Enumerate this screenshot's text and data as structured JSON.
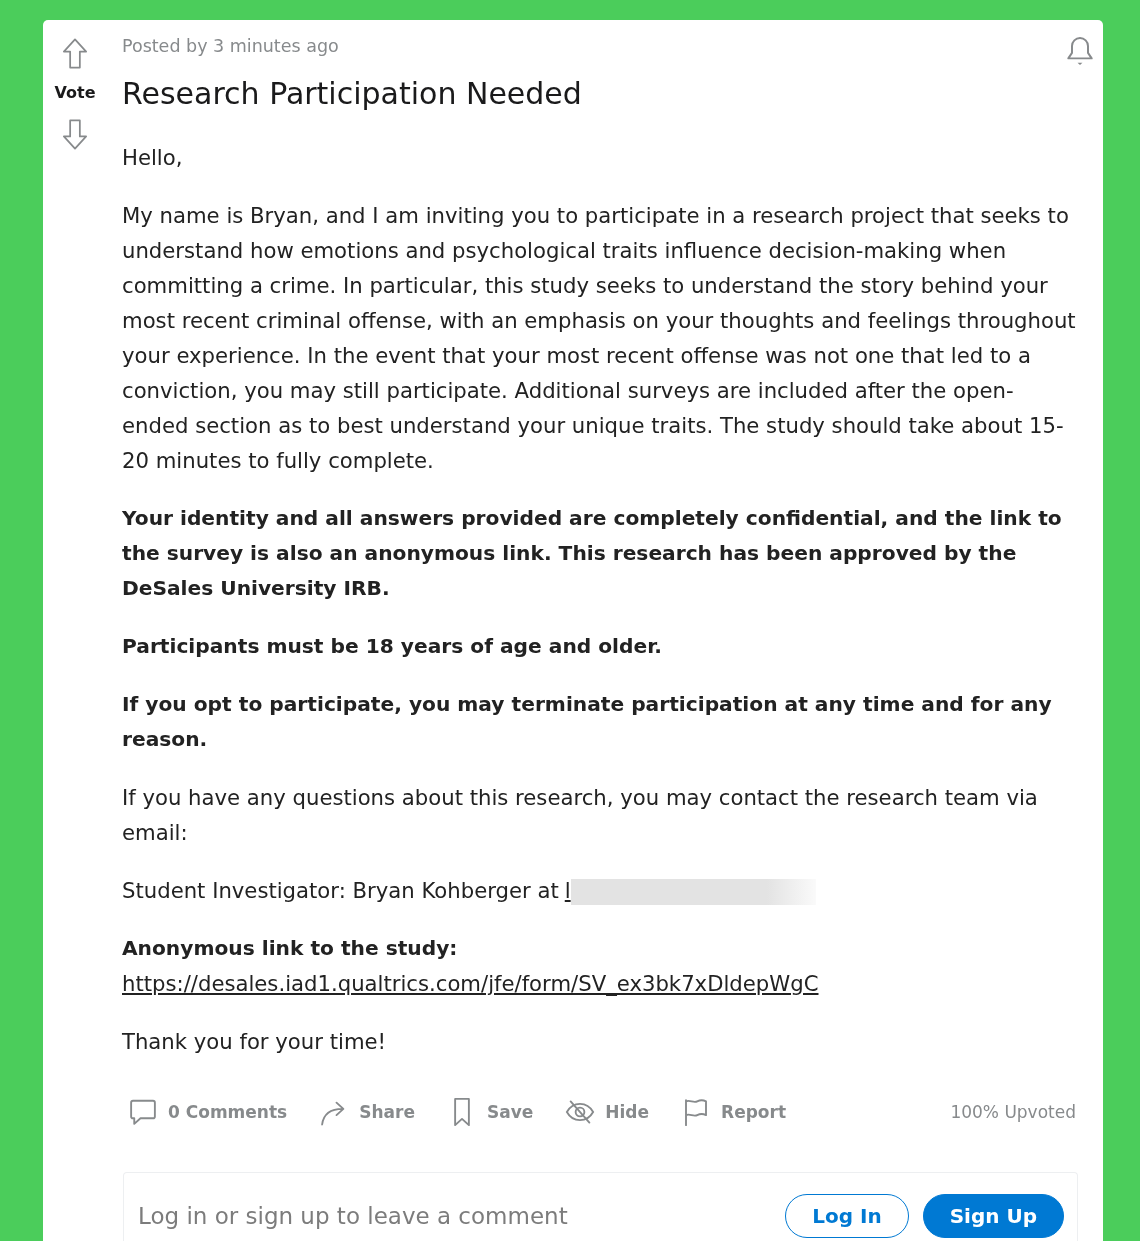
{
  "vote": {
    "label": "Vote"
  },
  "post": {
    "meta": "Posted by 3 minutes ago",
    "title": "Research Participation Needed"
  },
  "body": [
    {
      "kind": "text",
      "text": "Hello,"
    },
    {
      "kind": "text",
      "text": "My name is Bryan, and I am inviting you to participate in a research project that seeks to understand how emotions and psychological traits influence decision-making when committing a crime. In particular, this study seeks to understand the story behind your most recent criminal offense, with an emphasis on your thoughts and feelings throughout your experience. In the event that your most recent offense was not one that led to a conviction, you may still participate. Additional surveys are included after the open-ended section as to best understand your unique traits. The study should take about 15-20 minutes to fully complete."
    },
    {
      "kind": "bold",
      "text": "Your identity and all answers provided are completely confidential, and the link to the survey is also an anonymous link. This research has been approved by the DeSales University IRB."
    },
    {
      "kind": "bold",
      "text": "Participants must be 18 years of age and older."
    },
    {
      "kind": "bold",
      "text": "If you opt to participate, you may terminate participation at any time and for any reason."
    },
    {
      "kind": "text",
      "text": "If you have any questions about this research, you may contact the research team via email:"
    },
    {
      "kind": "contact",
      "text": "Student Investigator: Bryan Kohberger at",
      "link": "l",
      "redacted": true
    },
    {
      "kind": "link",
      "label": "Anonymous link to the study:",
      "url": "https://desales.iad1.qualtrics.com/jfe/form/SV_ex3bk7xDldepWgC"
    },
    {
      "kind": "text",
      "text": "Thank you for your time!"
    }
  ],
  "actions": [
    {
      "kind": "comments",
      "label": "0 Comments"
    },
    {
      "kind": "share",
      "label": "Share"
    },
    {
      "kind": "save",
      "label": "Save"
    },
    {
      "kind": "hide",
      "label": "Hide"
    },
    {
      "kind": "report",
      "label": "Report"
    }
  ],
  "upvote_ratio": "100% Upvoted",
  "comment_box": {
    "prompt": "Log in or sign up to leave a comment",
    "buttons": [
      {
        "kind": "outline",
        "label": "Log In"
      },
      {
        "kind": "filled",
        "label": "Sign Up"
      }
    ]
  }
}
